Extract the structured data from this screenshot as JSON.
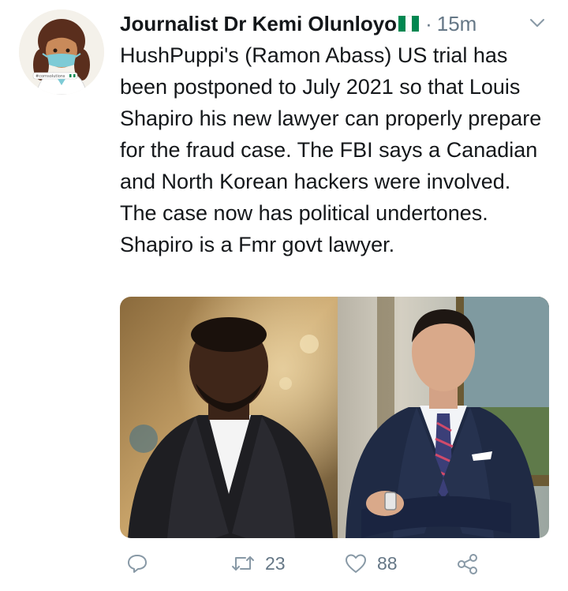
{
  "tweet": {
    "author": {
      "display_name": "Journalist Dr Kemi Olunloyo",
      "avatar_banner": "#cornsolutions"
    },
    "time_separator": "·",
    "timestamp": "15m",
    "text": "HushPuppi's (Ramon Abass) US trial has been postponed to July 2021 so that Louis Shapiro his new lawyer can properly prepare for the fraud case. The FBI says a Canadian and North Korean hackers were involved. The case now has political undertones. Shapiro is a Fmr govt lawyer.",
    "media": {
      "left_photo": "man-in-black-tuxedo-photo",
      "right_photo": "man-in-navy-suit-photo"
    },
    "actions": {
      "reply_icon": "reply-icon",
      "retweet_icon": "retweet-icon",
      "retweet_count": "23",
      "like_icon": "heart-icon",
      "like_count": "88",
      "share_icon": "share-icon"
    }
  },
  "colors": {
    "text_primary": "#14171a",
    "text_secondary": "#657786",
    "flag_green": "#008751",
    "flag_white": "#ffffff"
  }
}
